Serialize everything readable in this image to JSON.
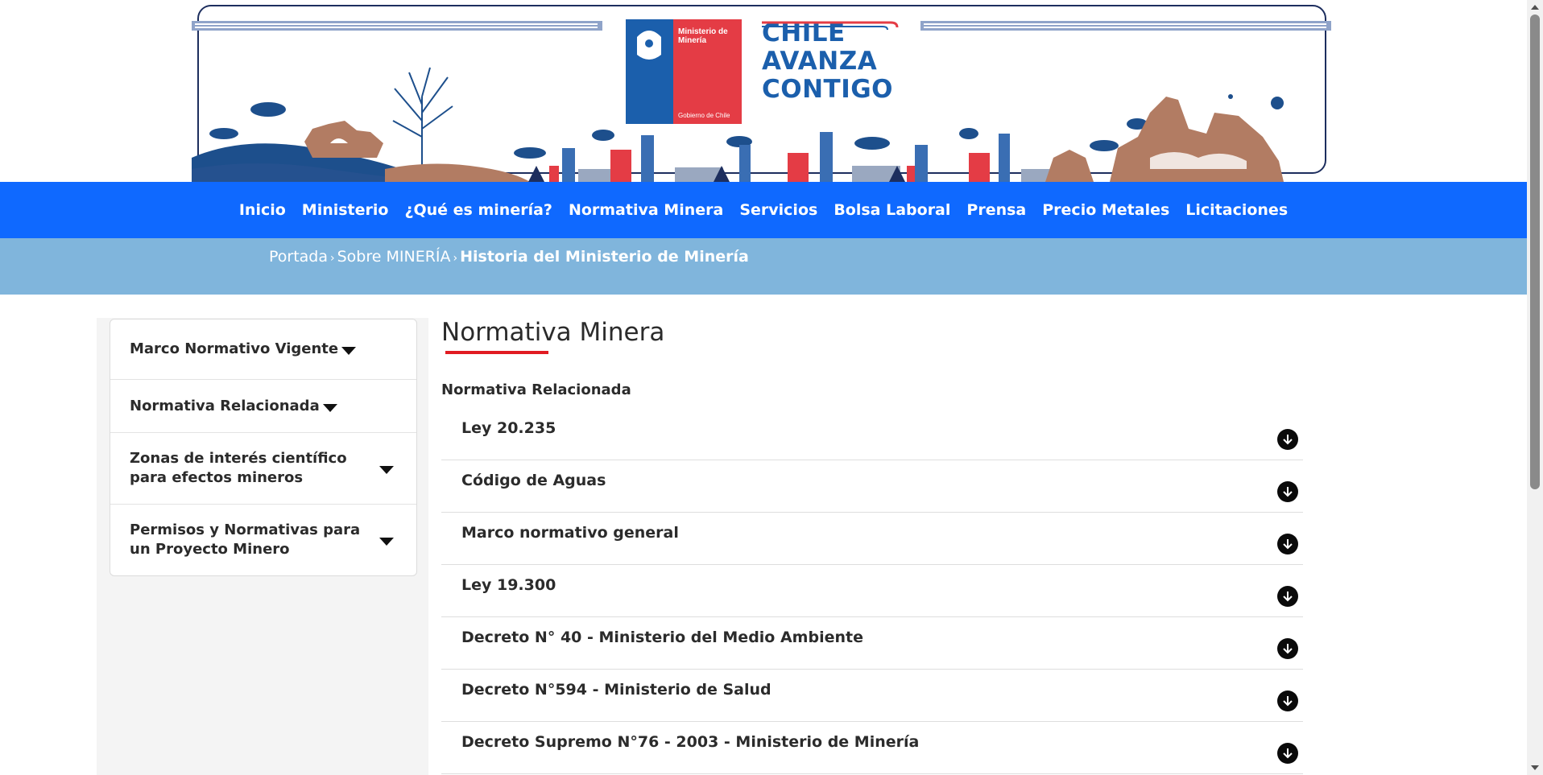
{
  "header": {
    "logo": {
      "ministry": "Ministerio de Minería",
      "government": "Gobierno de Chile"
    },
    "slogan": [
      "CHILE",
      "AVANZA",
      "CONTIGO"
    ],
    "colors": {
      "brand_blue": "#1b5fac",
      "brand_red": "#e43c45"
    }
  },
  "nav": {
    "items": [
      "Inicio",
      "Ministerio",
      "¿Qué es minería?",
      "Normativa Minera",
      "Servicios",
      "Bolsa Laboral",
      "Prensa",
      "Precio Metales",
      "Licitaciones"
    ],
    "color": "#0f69ff"
  },
  "breadcrumb": {
    "items": [
      "Portada",
      "Sobre MINERÍA"
    ],
    "current": "Historia del Ministerio de Minería",
    "separator": "›",
    "color": "#80b5dc"
  },
  "sidebar": {
    "items": [
      "Marco Normativo Vigente",
      "Normativa Relacionada",
      "Zonas de interés científico para efectos mineros",
      "Permisos y Normativas para un Proyecto Minero"
    ]
  },
  "main": {
    "title": "Normativa Minera",
    "accent": "#e11b22",
    "subtitle": "Normativa Relacionada",
    "accordion": [
      "Ley 20.235",
      "Código de Aguas",
      "Marco normativo general",
      "Ley 19.300",
      "Decreto N° 40 - Ministerio del Medio Ambiente",
      "Decreto N°594 - Ministerio de Salud",
      "Decreto Supremo N°76 - 2003 - Ministerio de Minería"
    ],
    "accordion_icon": "arrow-down-circle-icon"
  }
}
